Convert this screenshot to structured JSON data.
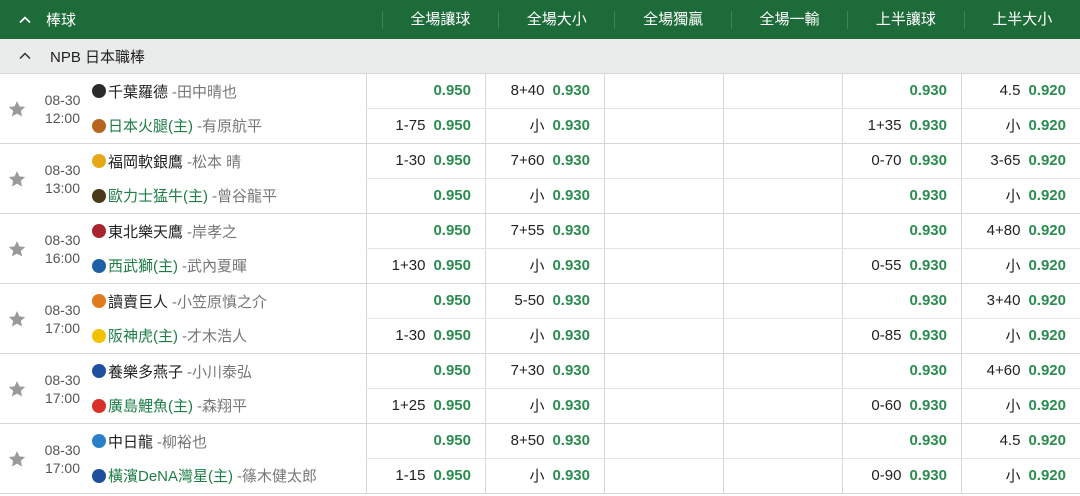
{
  "header": {
    "sport": "棒球",
    "columns": [
      "全場讓球",
      "全場大小",
      "全場獨贏",
      "全場一輸",
      "上半讓球",
      "上半大小"
    ]
  },
  "league": {
    "name": "NPB 日本職棒"
  },
  "matches": [
    {
      "date": "08-30",
      "time": "12:00",
      "away": {
        "name": "千葉羅德",
        "pitcher": "-田中晴也",
        "icon_color": "#2b2b2b"
      },
      "home": {
        "name": "日本火腿(主)",
        "pitcher": "-有原航平",
        "icon_color": "#b5651d"
      },
      "top": [
        {
          "line": "",
          "odd": "0.950"
        },
        {
          "line": "8+40",
          "odd": "0.930"
        },
        {
          "line": "",
          "odd": ""
        },
        {
          "line": "",
          "odd": ""
        },
        {
          "line": "",
          "odd": "0.930"
        },
        {
          "line": "4.5",
          "odd": "0.920"
        }
      ],
      "bottom": [
        {
          "line": "1-75",
          "odd": "0.950"
        },
        {
          "line": "小",
          "odd": "0.930"
        },
        {
          "line": "",
          "odd": ""
        },
        {
          "line": "",
          "odd": ""
        },
        {
          "line": "1+35",
          "odd": "0.930"
        },
        {
          "line": "小",
          "odd": "0.920"
        }
      ]
    },
    {
      "date": "08-30",
      "time": "13:00",
      "away": {
        "name": "福岡軟銀鷹",
        "pitcher": "-松本 晴",
        "icon_color": "#e6a817"
      },
      "home": {
        "name": "歐力士猛牛(主)",
        "pitcher": "-曾谷龍平",
        "icon_color": "#4a3a1a"
      },
      "top": [
        {
          "line": "1-30",
          "odd": "0.950"
        },
        {
          "line": "7+60",
          "odd": "0.930"
        },
        {
          "line": "",
          "odd": ""
        },
        {
          "line": "",
          "odd": ""
        },
        {
          "line": "0-70",
          "odd": "0.930"
        },
        {
          "line": "3-65",
          "odd": "0.920"
        }
      ],
      "bottom": [
        {
          "line": "",
          "odd": "0.950"
        },
        {
          "line": "小",
          "odd": "0.930"
        },
        {
          "line": "",
          "odd": ""
        },
        {
          "line": "",
          "odd": ""
        },
        {
          "line": "",
          "odd": "0.930"
        },
        {
          "line": "小",
          "odd": "0.920"
        }
      ]
    },
    {
      "date": "08-30",
      "time": "16:00",
      "away": {
        "name": "東北樂天鷹",
        "pitcher": "-岸孝之",
        "icon_color": "#a8242e"
      },
      "home": {
        "name": "西武獅(主)",
        "pitcher": "-武內夏暉",
        "icon_color": "#1f5fa8"
      },
      "top": [
        {
          "line": "",
          "odd": "0.950"
        },
        {
          "line": "7+55",
          "odd": "0.930"
        },
        {
          "line": "",
          "odd": ""
        },
        {
          "line": "",
          "odd": ""
        },
        {
          "line": "",
          "odd": "0.930"
        },
        {
          "line": "4+80",
          "odd": "0.920"
        }
      ],
      "bottom": [
        {
          "line": "1+30",
          "odd": "0.950"
        },
        {
          "line": "小",
          "odd": "0.930"
        },
        {
          "line": "",
          "odd": ""
        },
        {
          "line": "",
          "odd": ""
        },
        {
          "line": "0-55",
          "odd": "0.930"
        },
        {
          "line": "小",
          "odd": "0.920"
        }
      ]
    },
    {
      "date": "08-30",
      "time": "17:00",
      "away": {
        "name": "讀賣巨人",
        "pitcher": "-小笠原慎之介",
        "icon_color": "#e07a1f"
      },
      "home": {
        "name": "阪神虎(主)",
        "pitcher": "-才木浩人",
        "icon_color": "#f2c200"
      },
      "top": [
        {
          "line": "",
          "odd": "0.950"
        },
        {
          "line": "5-50",
          "odd": "0.930"
        },
        {
          "line": "",
          "odd": ""
        },
        {
          "line": "",
          "odd": ""
        },
        {
          "line": "",
          "odd": "0.930"
        },
        {
          "line": "3+40",
          "odd": "0.920"
        }
      ],
      "bottom": [
        {
          "line": "1-30",
          "odd": "0.950"
        },
        {
          "line": "小",
          "odd": "0.930"
        },
        {
          "line": "",
          "odd": ""
        },
        {
          "line": "",
          "odd": ""
        },
        {
          "line": "0-85",
          "odd": "0.930"
        },
        {
          "line": "小",
          "odd": "0.920"
        }
      ]
    },
    {
      "date": "08-30",
      "time": "17:00",
      "away": {
        "name": "養樂多燕子",
        "pitcher": "-小川泰弘",
        "icon_color": "#1f4fa0"
      },
      "home": {
        "name": "廣島鯉魚(主)",
        "pitcher": "-森翔平",
        "icon_color": "#d9302b"
      },
      "top": [
        {
          "line": "",
          "odd": "0.950"
        },
        {
          "line": "7+30",
          "odd": "0.930"
        },
        {
          "line": "",
          "odd": ""
        },
        {
          "line": "",
          "odd": ""
        },
        {
          "line": "",
          "odd": "0.930"
        },
        {
          "line": "4+60",
          "odd": "0.920"
        }
      ],
      "bottom": [
        {
          "line": "1+25",
          "odd": "0.950"
        },
        {
          "line": "小",
          "odd": "0.930"
        },
        {
          "line": "",
          "odd": ""
        },
        {
          "line": "",
          "odd": ""
        },
        {
          "line": "0-60",
          "odd": "0.930"
        },
        {
          "line": "小",
          "odd": "0.920"
        }
      ]
    },
    {
      "date": "08-30",
      "time": "17:00",
      "away": {
        "name": "中日龍",
        "pitcher": "-柳裕也",
        "icon_color": "#2a7fc9"
      },
      "home": {
        "name": "橫濱DeNA灣星(主)",
        "pitcher": "-篠木健太郎",
        "icon_color": "#1e4f9e"
      },
      "top": [
        {
          "line": "",
          "odd": "0.950"
        },
        {
          "line": "8+50",
          "odd": "0.930"
        },
        {
          "line": "",
          "odd": ""
        },
        {
          "line": "",
          "odd": ""
        },
        {
          "line": "",
          "odd": "0.930"
        },
        {
          "line": "4.5",
          "odd": "0.920"
        }
      ],
      "bottom": [
        {
          "line": "1-15",
          "odd": "0.950"
        },
        {
          "line": "小",
          "odd": "0.930"
        },
        {
          "line": "",
          "odd": ""
        },
        {
          "line": "",
          "odd": ""
        },
        {
          "line": "0-90",
          "odd": "0.930"
        },
        {
          "line": "小",
          "odd": "0.920"
        }
      ]
    }
  ]
}
